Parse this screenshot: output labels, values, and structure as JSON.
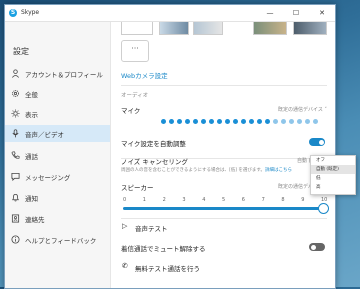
{
  "window": {
    "title": "Skype"
  },
  "sidebar": {
    "heading": "設定",
    "items": [
      {
        "label": "アカウント＆プロフィール",
        "icon": "person-icon"
      },
      {
        "label": "全般",
        "icon": "gear-icon"
      },
      {
        "label": "表示",
        "icon": "brightness-icon"
      },
      {
        "label": "音声／ビデオ",
        "icon": "microphone-icon",
        "active": true
      },
      {
        "label": "通話",
        "icon": "phone-icon"
      },
      {
        "label": "メッセージング",
        "icon": "chat-icon"
      },
      {
        "label": "通知",
        "icon": "bell-icon"
      },
      {
        "label": "連絡先",
        "icon": "contacts-icon"
      },
      {
        "label": "ヘルプとフィードバック",
        "icon": "info-icon"
      }
    ]
  },
  "main": {
    "more_button": "···",
    "webcam_link": "Webカメラ設定",
    "audio_section": "オーディオ",
    "mic": {
      "label": "マイク",
      "device": "既定の通信デバイス ˅",
      "level_active_dots": 14,
      "level_total_dots": 20
    },
    "auto_adjust": {
      "label": "マイク設定を自動調整",
      "on": true
    },
    "noise": {
      "label": "ノイズ キャンセリング",
      "value": "自動 (",
      "desc": "周囲の人の音を含むことができるようにする場合は、[低] を選びます。",
      "link": "詳細はこちら"
    },
    "speaker": {
      "label": "スピーカー",
      "device": "既定の通信デバイス ˅",
      "ticks": [
        "0",
        "1",
        "2",
        "3",
        "4",
        "5",
        "6",
        "7",
        "8",
        "9",
        "10"
      ],
      "volume": 1.0
    },
    "test_audio": "音声テスト",
    "unmute": {
      "label": "着信通話でミュート解除する",
      "on": false
    },
    "free_test_call": "無料テスト通話を行う"
  },
  "dropdown": {
    "options": [
      "オフ",
      "自動 (既定)",
      "低",
      "高"
    ],
    "selected_index": 1
  },
  "colors": {
    "accent": "#1a88c8",
    "active_nav": "#d6e9f8"
  }
}
